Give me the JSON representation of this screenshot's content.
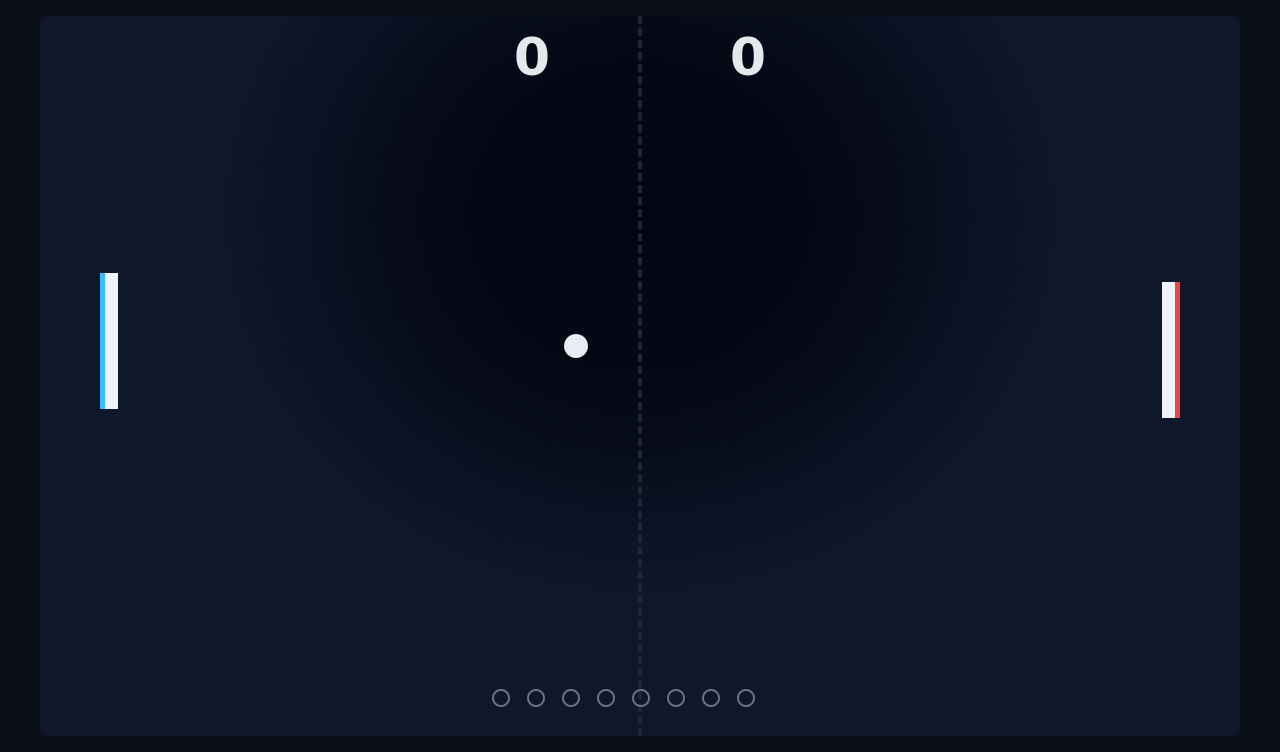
{
  "scoreboard": {
    "left_score": "0",
    "right_score": "0"
  },
  "players": {
    "left": {
      "paddle_color": "#38bdf8",
      "paddle_fill": "#f1f5f9"
    },
    "right": {
      "paddle_color": "#ef4444",
      "paddle_fill": "#f1f5f9"
    }
  },
  "ball": {
    "color": "#e8edf3"
  },
  "rally_indicator": {
    "total": 8,
    "filled": 0,
    "color": "#6b7280"
  },
  "theme": {
    "background": "#0b0f19",
    "board": "#0f172a",
    "text": "#e5e7eb"
  }
}
